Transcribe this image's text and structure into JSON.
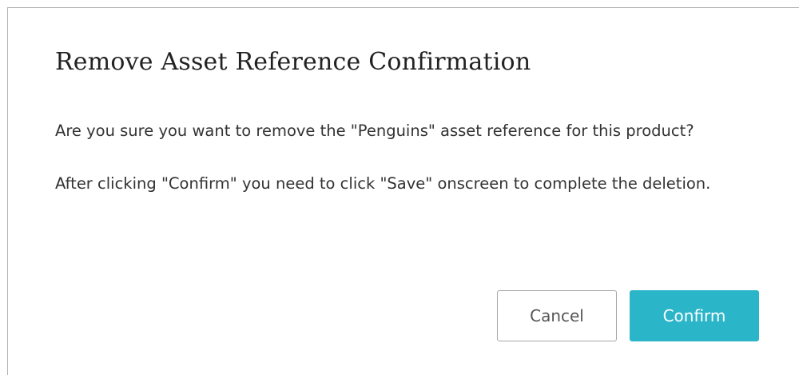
{
  "dialog": {
    "title": "Remove Asset Reference Confirmation",
    "message_line": "Are you sure you want to remove the \"Penguins\" asset reference for this product?",
    "instruction_line": "After clicking \"Confirm\" you need to click \"Save\" onscreen to complete the deletion.",
    "cancel_label": "Cancel",
    "confirm_label": "Confirm"
  },
  "colors": {
    "confirm_button": "#2bb5c9",
    "cancel_border": "#a6a6a6",
    "dialog_border": "#b3b3b3"
  }
}
